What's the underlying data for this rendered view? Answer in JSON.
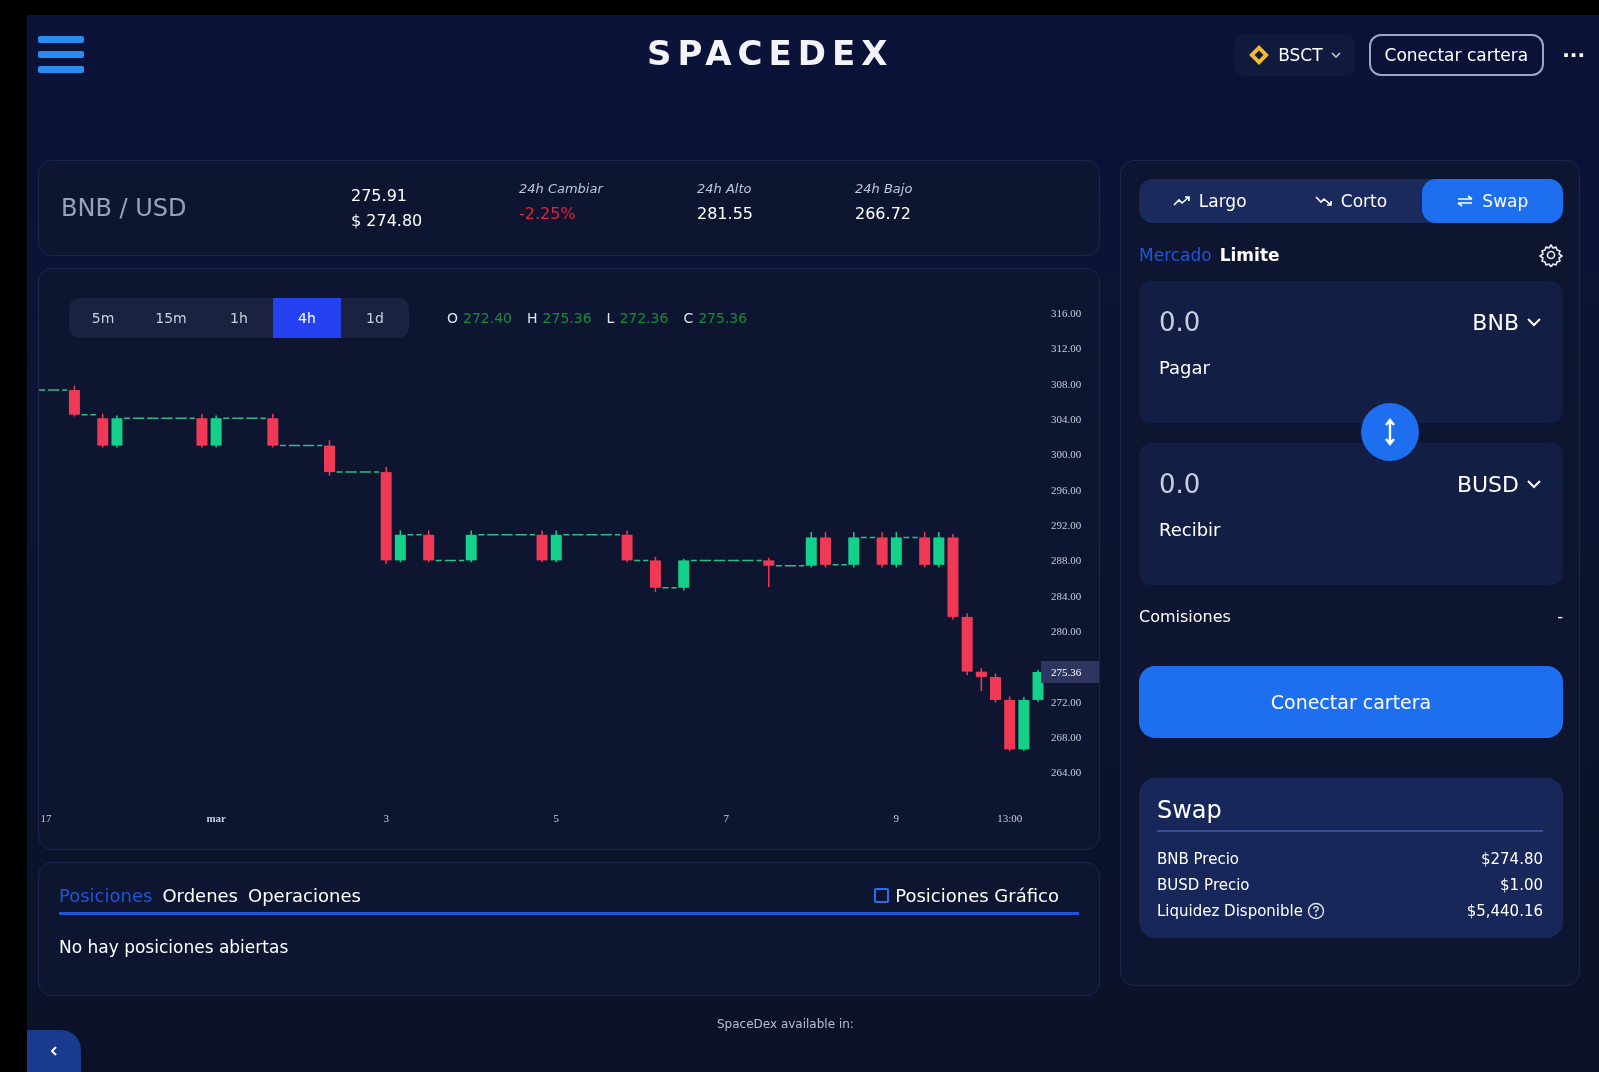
{
  "header": {
    "logo": "SPACEDEX",
    "network": "BSCT",
    "connect_button": "Conectar cartera",
    "more": "···"
  },
  "ticker": {
    "pair": "BNB / USD",
    "price": "275.91",
    "usd_price": "$ 274.80",
    "stats": [
      {
        "label": "24h Cambiar",
        "value": "-2.25%",
        "kind": "down"
      },
      {
        "label": "24h Alto",
        "value": "281.55",
        "kind": "plain"
      },
      {
        "label": "24h Bajo",
        "value": "266.72",
        "kind": "plain"
      }
    ]
  },
  "chart": {
    "intervals": [
      {
        "label": "5m",
        "selected": false
      },
      {
        "label": "15m",
        "selected": false
      },
      {
        "label": "1h",
        "selected": false
      },
      {
        "label": "4h",
        "selected": true
      },
      {
        "label": "1d",
        "selected": false
      }
    ],
    "ohlc": [
      {
        "key": "O",
        "value": "272.40"
      },
      {
        "key": "H",
        "value": "275.36"
      },
      {
        "key": "L",
        "value": "272.36"
      },
      {
        "key": "C",
        "value": "275.36"
      }
    ],
    "chart_data": {
      "type": "candlestick",
      "categories": [
        "17",
        null,
        null,
        null,
        null,
        null,
        null,
        null,
        null,
        null,
        null,
        null,
        "mar",
        null,
        null,
        null,
        null,
        null,
        null,
        null,
        null,
        null,
        null,
        null,
        "3",
        null,
        null,
        null,
        null,
        null,
        null,
        null,
        null,
        null,
        null,
        null,
        "5",
        null,
        null,
        null,
        null,
        null,
        null,
        null,
        null,
        null,
        null,
        null,
        "7",
        null,
        null,
        null,
        null,
        null,
        null,
        null,
        null,
        null,
        null,
        null,
        "9",
        null,
        null,
        null,
        null,
        null,
        null,
        null,
        "13:00",
        null,
        null
      ],
      "ohlc": [
        [
          307.3,
          307.3,
          307.3,
          307.3
        ],
        [
          307.3,
          307.3,
          307.3,
          307.3
        ],
        [
          307.3,
          307.8,
          304.3,
          304.5
        ],
        [
          304.5,
          304.5,
          304.5,
          304.5
        ],
        [
          304.1,
          304.6,
          300.8,
          301.0
        ],
        [
          301.0,
          304.4,
          300.8,
          304.1
        ],
        [
          304.1,
          304.1,
          304.1,
          304.1
        ],
        [
          304.1,
          304.1,
          304.1,
          304.1
        ],
        [
          304.1,
          304.1,
          304.1,
          304.1
        ],
        [
          304.1,
          304.1,
          304.1,
          304.1
        ],
        [
          304.1,
          304.1,
          304.1,
          304.1
        ],
        [
          304.1,
          304.6,
          300.8,
          301.0
        ],
        [
          301.0,
          304.4,
          300.8,
          304.1
        ],
        [
          304.1,
          304.1,
          304.1,
          304.1
        ],
        [
          304.1,
          304.1,
          304.1,
          304.1
        ],
        [
          304.1,
          304.1,
          304.1,
          304.1
        ],
        [
          304.1,
          304.6,
          300.8,
          301.0
        ],
        [
          301.0,
          301.0,
          301.0,
          301.0
        ],
        [
          301.0,
          301.0,
          301.0,
          301.0
        ],
        [
          301.0,
          301.0,
          301.0,
          301.0
        ],
        [
          301.0,
          301.6,
          297.6,
          298.0
        ],
        [
          298.0,
          298.0,
          298.0,
          298.0
        ],
        [
          298.0,
          298.0,
          298.0,
          298.0
        ],
        [
          298.0,
          298.0,
          298.0,
          298.0
        ],
        [
          298.0,
          298.6,
          287.6,
          288.0
        ],
        [
          288.0,
          291.4,
          287.8,
          290.9
        ],
        [
          290.9,
          290.9,
          290.9,
          290.9
        ],
        [
          290.9,
          291.4,
          287.8,
          288.0
        ],
        [
          288.0,
          288.0,
          288.0,
          288.0
        ],
        [
          288.0,
          288.0,
          288.0,
          288.0
        ],
        [
          288.0,
          291.4,
          287.8,
          290.9
        ],
        [
          290.9,
          290.9,
          290.9,
          290.9
        ],
        [
          290.9,
          290.9,
          290.9,
          290.9
        ],
        [
          290.9,
          290.9,
          290.9,
          290.9
        ],
        [
          290.9,
          290.9,
          290.9,
          290.9
        ],
        [
          290.9,
          291.4,
          287.8,
          288.0
        ],
        [
          288.0,
          291.4,
          287.8,
          290.9
        ],
        [
          290.9,
          290.9,
          290.9,
          290.9
        ],
        [
          290.9,
          290.9,
          290.9,
          290.9
        ],
        [
          290.9,
          290.9,
          290.9,
          290.9
        ],
        [
          290.9,
          290.9,
          290.9,
          290.9
        ],
        [
          290.9,
          291.4,
          287.8,
          288.0
        ],
        [
          288.0,
          288.0,
          288.0,
          288.0
        ],
        [
          288.0,
          288.4,
          284.4,
          284.9
        ],
        [
          284.9,
          284.9,
          284.9,
          284.9
        ],
        [
          284.9,
          288.2,
          284.6,
          288.0
        ],
        [
          288.0,
          288.0,
          288.0,
          288.0
        ],
        [
          288.0,
          288.0,
          288.0,
          288.0
        ],
        [
          288.0,
          288.0,
          288.0,
          288.0
        ],
        [
          288.0,
          288.0,
          288.0,
          288.0
        ],
        [
          288.0,
          288.0,
          288.0,
          288.0
        ],
        [
          288.0,
          288.3,
          285.0,
          287.4
        ],
        [
          287.4,
          287.4,
          287.4,
          287.4
        ],
        [
          287.4,
          287.4,
          287.4,
          287.4
        ],
        [
          287.4,
          291.2,
          287.2,
          290.6
        ],
        [
          290.6,
          291.2,
          287.2,
          287.5
        ],
        [
          287.5,
          287.5,
          287.5,
          287.5
        ],
        [
          287.5,
          291.2,
          287.2,
          290.6
        ],
        [
          290.6,
          290.6,
          290.6,
          290.6
        ],
        [
          290.6,
          291.2,
          287.2,
          287.5
        ],
        [
          287.5,
          291.2,
          287.2,
          290.6
        ],
        [
          290.6,
          290.6,
          290.6,
          290.6
        ],
        [
          290.6,
          291.2,
          287.2,
          287.5
        ],
        [
          287.5,
          291.2,
          287.2,
          290.6
        ],
        [
          290.6,
          291.0,
          281.3,
          281.6
        ],
        [
          281.6,
          282.0,
          275.0,
          275.4
        ],
        [
          275.4,
          275.8,
          273.2,
          274.8
        ],
        [
          274.8,
          275.2,
          271.9,
          272.2
        ],
        [
          272.2,
          272.6,
          266.4,
          266.6
        ],
        [
          266.6,
          272.5,
          266.4,
          272.2
        ],
        [
          272.2,
          275.6,
          272.0,
          275.36
        ]
      ],
      "ylim": [
        264,
        316
      ],
      "yticks": [
        {
          "value": 316,
          "label": "316.00"
        },
        {
          "value": 312,
          "label": "312.00"
        },
        {
          "value": 308,
          "label": "308.00"
        },
        {
          "value": 304,
          "label": "304.00"
        },
        {
          "value": 300,
          "label": "300.00"
        },
        {
          "value": 296,
          "label": "296.00"
        },
        {
          "value": 292,
          "label": "292.00"
        },
        {
          "value": 288,
          "label": "288.00"
        },
        {
          "value": 284,
          "label": "284.00"
        },
        {
          "value": 280,
          "label": "280.00"
        },
        {
          "value": 272,
          "label": "272.00"
        },
        {
          "value": 268,
          "label": "268.00"
        },
        {
          "value": 264,
          "label": "264.00"
        }
      ],
      "annotations": [
        "275.36"
      ]
    }
  },
  "positions": {
    "tabs": [
      {
        "label": "Posiciones",
        "selected": true
      },
      {
        "label": "Ordenes",
        "selected": false
      },
      {
        "label": "Operaciones",
        "selected": false
      }
    ],
    "chart_toggle": {
      "label": "Posiciones Gráfico",
      "checked": false
    },
    "empty": "No hay posiciones abiertas"
  },
  "trade": {
    "sides": [
      {
        "label": "Largo",
        "kind": "long",
        "selected": false
      },
      {
        "label": "Corto",
        "kind": "short",
        "selected": false
      },
      {
        "label": "Swap",
        "kind": "swap",
        "selected": true
      }
    ],
    "order_types": [
      {
        "label": "Mercado",
        "selected": true
      },
      {
        "label": "Limite",
        "selected": false
      }
    ],
    "pay": {
      "amount": "0.0",
      "label": "Pagar",
      "token": "BNB"
    },
    "receive": {
      "amount": "0.0",
      "label": "Recibir",
      "token": "BUSD"
    },
    "fees": {
      "label": "Comisiones",
      "value": "-"
    },
    "connect_button": "Conectar cartera",
    "info": {
      "title": "Swap",
      "rows": [
        {
          "label": "BNB Precio",
          "value": "$274.80",
          "help": false
        },
        {
          "label": "BUSD Precio",
          "value": "$1.00",
          "help": false
        },
        {
          "label": "Liquidez Disponible",
          "value": "$5,440.16",
          "help": true
        }
      ]
    }
  },
  "footer": {
    "text": "SpaceDex available in:"
  }
}
